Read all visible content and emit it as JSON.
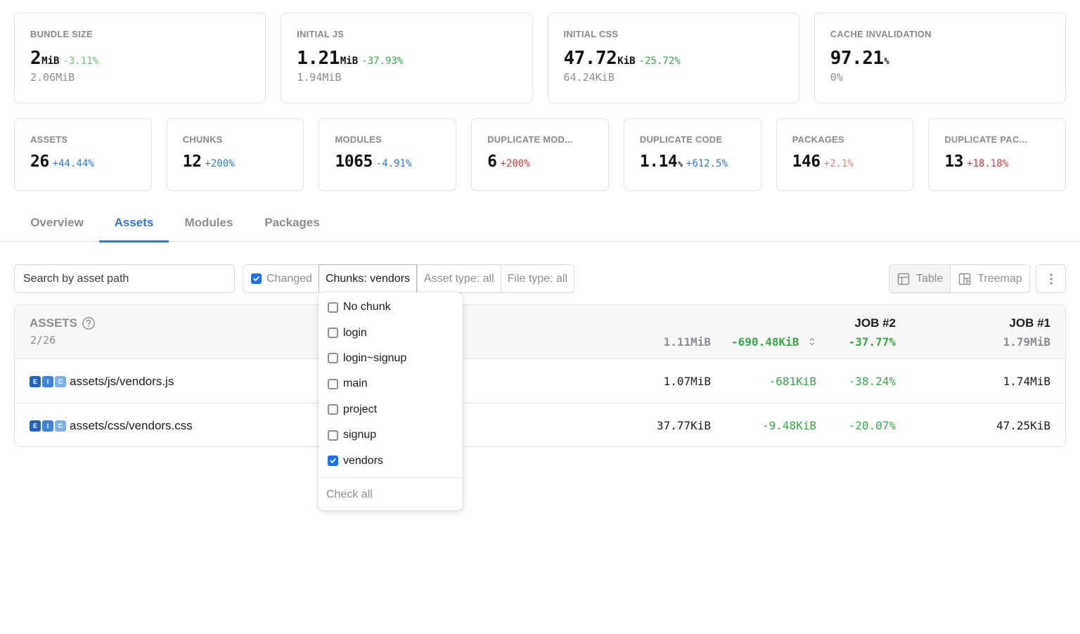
{
  "metrics_primary": [
    {
      "label": "Bundle size",
      "value": "2",
      "unit": "MiB",
      "delta": "-3.11%",
      "delta_color": "#6cc278",
      "baseline": "2.06MiB"
    },
    {
      "label": "Initial JS",
      "value": "1.21",
      "unit": "MiB",
      "delta": "-37.93%",
      "delta_color": "#3aa84a",
      "baseline": "1.94MiB"
    },
    {
      "label": "Initial CSS",
      "value": "47.72",
      "unit": "KiB",
      "delta": "-25.72%",
      "delta_color": "#3aa84a",
      "baseline": "64.24KiB"
    },
    {
      "label": "Cache invalidation",
      "value": "97.21",
      "unit": "%",
      "delta": "",
      "delta_color": "",
      "baseline": "0%"
    }
  ],
  "metrics_secondary": [
    {
      "label": "Assets",
      "value": "26",
      "unit": "",
      "delta": "+44.44%",
      "delta_color": "#2f78d0"
    },
    {
      "label": "Chunks",
      "value": "12",
      "unit": "",
      "delta": "+200%",
      "delta_color": "#2f78d0"
    },
    {
      "label": "Modules",
      "value": "1065",
      "unit": "",
      "delta": "-4.91%",
      "delta_color": "#2f78d0"
    },
    {
      "label": "Duplicate mod...",
      "value": "6",
      "unit": "",
      "delta": "+200%",
      "delta_color": "#d8393f"
    },
    {
      "label": "Duplicate code",
      "value": "1.14",
      "unit": "%",
      "delta": "+612.5%",
      "delta_color": "#2f78d0"
    },
    {
      "label": "Packages",
      "value": "146",
      "unit": "",
      "delta": "+2.1%",
      "delta_color": "#e47f84"
    },
    {
      "label": "Duplicate pac...",
      "value": "13",
      "unit": "",
      "delta": "+18.18%",
      "delta_color": "#d8393f"
    }
  ],
  "tabs": [
    {
      "label": "Overview",
      "active": false
    },
    {
      "label": "Assets",
      "active": true
    },
    {
      "label": "Modules",
      "active": false
    },
    {
      "label": "Packages",
      "active": false
    }
  ],
  "toolbar": {
    "search_placeholder": "Search by asset path",
    "search_value": "",
    "changed_label": "Changed",
    "changed_checked": true,
    "chunks_filter": "Chunks: vendors",
    "asset_type_filter": "Asset type: all",
    "file_type_filter": "File type: all",
    "view_table": "Table",
    "view_treemap": "Treemap"
  },
  "chunks_dropdown": {
    "options": [
      {
        "label": "No chunk",
        "checked": false
      },
      {
        "label": "login",
        "checked": false
      },
      {
        "label": "login~signup",
        "checked": false
      },
      {
        "label": "main",
        "checked": false
      },
      {
        "label": "project",
        "checked": false
      },
      {
        "label": "signup",
        "checked": false
      },
      {
        "label": "vendors",
        "checked": true
      }
    ],
    "check_all": "Check all"
  },
  "table": {
    "title": "Assets",
    "count": "2/26",
    "job2_label": "JOB #2",
    "job1_label": "JOB #1",
    "totals": {
      "job2_size": "1.11MiB",
      "delta": "-690.48KiB",
      "delta_pct": "-37.77%",
      "job1_size": "1.79MiB"
    },
    "rows": [
      {
        "badges": [
          "E",
          "I",
          "C"
        ],
        "path": "assets/js/vendors.js",
        "job2_size": "1.07MiB",
        "delta": "-681KiB",
        "delta_pct": "-38.24%",
        "job1_size": "1.74MiB"
      },
      {
        "badges": [
          "E",
          "I",
          "C"
        ],
        "path": "assets/css/vendors.css",
        "job2_size": "37.77KiB",
        "delta": "-9.48KiB",
        "delta_pct": "-20.07%",
        "job1_size": "47.25KiB"
      }
    ]
  },
  "colors": {
    "accent": "#2f78d0",
    "positive": "#3aa84a",
    "negative": "#d8393f",
    "checkbox": "#1f6fe6"
  }
}
